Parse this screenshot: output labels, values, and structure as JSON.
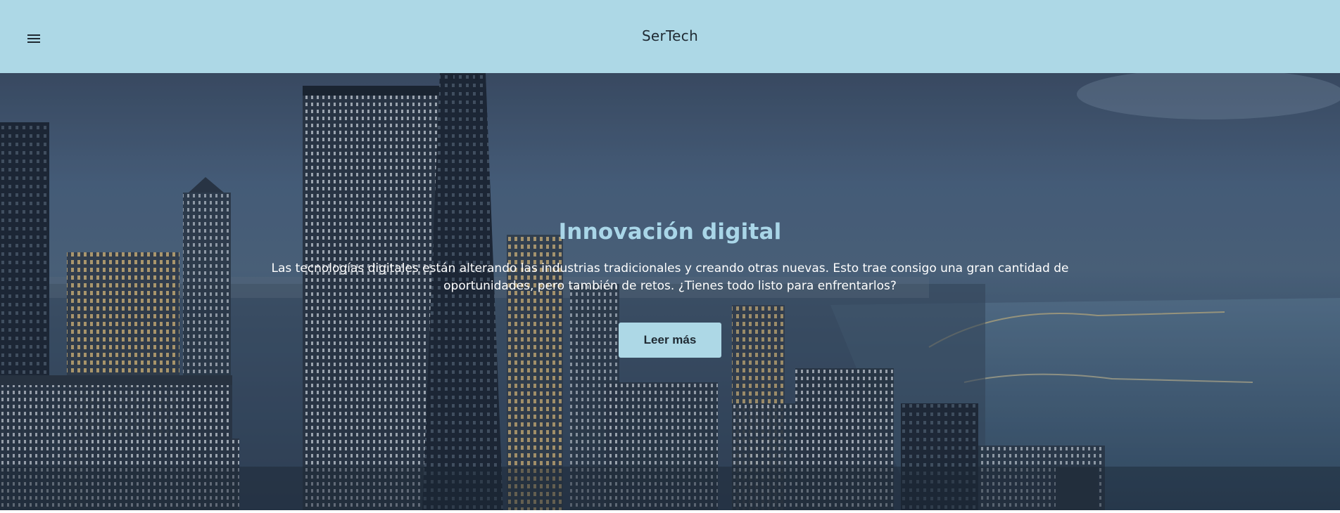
{
  "header": {
    "brand": "SerTech",
    "menu_icon": "hamburger-menu-icon",
    "background_color": "#add8e6"
  },
  "hero": {
    "background_image": "night city skyline with lake shore",
    "title": "Innovación digital",
    "text": "Las tecnologías digitales están alterando las industrias tradicionales y creando otras nuevas. Esto trae consigo una gran cantidad de oportunidades, pero también de retos. ¿Tienes todo listo para enfrentarlos?",
    "cta_label": "Leer más",
    "title_color": "#a9d6e8",
    "button_color": "#add8e6"
  }
}
